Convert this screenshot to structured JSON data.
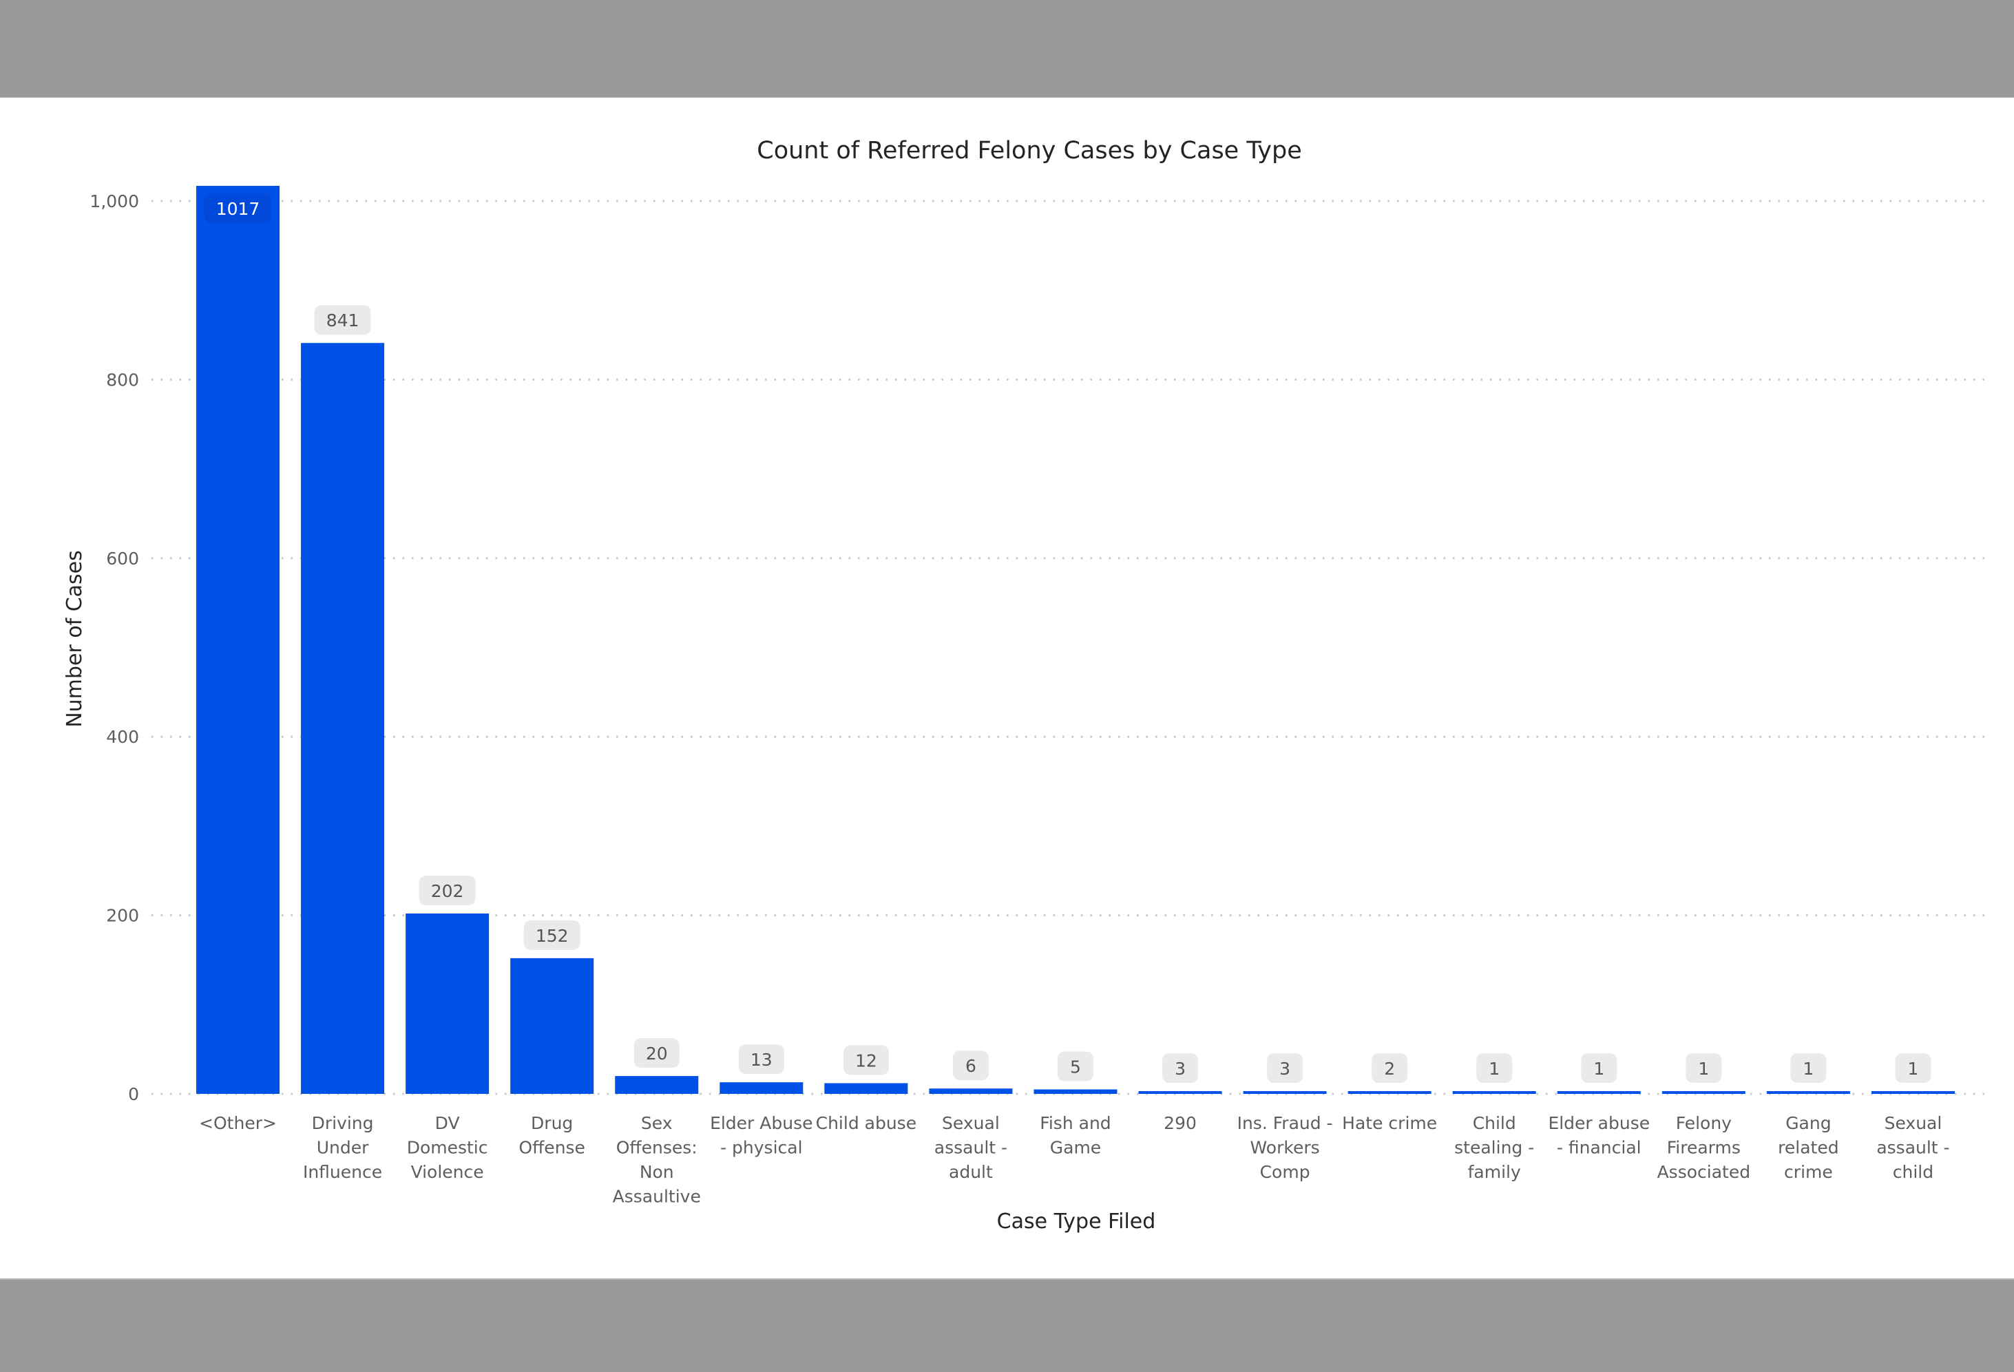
{
  "chart_data": {
    "type": "bar",
    "title": "Count of Referred Felony Cases by Case Type",
    "xlabel": "Case Type Filed",
    "ylabel": "Number of Cases",
    "ylim": [
      0,
      1017
    ],
    "yticks": [
      0,
      200,
      400,
      600,
      800,
      1000
    ],
    "ytick_labels": [
      "0",
      "200",
      "400",
      "600",
      "800",
      "1,000"
    ],
    "grid": true,
    "grid_style": "dotted",
    "legend": "none",
    "bar_color": "#0051E8",
    "categories": [
      "<Other>",
      "Driving Under Influence",
      "DV Domestic Violence",
      "Drug Offense",
      "Sex Offenses: Non Assaultive",
      "Elder Abuse - physical",
      "Child abuse",
      "Sexual assault - adult",
      "Fish and Game",
      "290",
      "Ins. Fraud - Workers Comp",
      "Hate crime",
      "Child stealing - family",
      "Elder abuse - financial",
      "Felony Firearms Associated",
      "Gang related crime",
      "Sexual assault - child"
    ],
    "category_lines": [
      [
        "<Other>"
      ],
      [
        "Driving",
        "Under",
        "Influence"
      ],
      [
        "DV",
        "Domestic",
        "Violence"
      ],
      [
        "Drug",
        "Offense"
      ],
      [
        "Sex",
        "Offenses:",
        "Non",
        "Assaultive"
      ],
      [
        "Elder Abuse",
        "- physical"
      ],
      [
        "Child abuse"
      ],
      [
        "Sexual",
        "assault -",
        "adult"
      ],
      [
        "Fish and",
        "Game"
      ],
      [
        "290"
      ],
      [
        "Ins. Fraud -",
        "Workers",
        "Comp"
      ],
      [
        "Hate crime"
      ],
      [
        "Child",
        "stealing -",
        "family"
      ],
      [
        "Elder abuse",
        "- financial"
      ],
      [
        "Felony",
        "Firearms",
        "Associated"
      ],
      [
        "Gang",
        "related",
        "crime"
      ],
      [
        "Sexual",
        "assault -",
        "child"
      ]
    ],
    "values": [
      1017,
      841,
      202,
      152,
      20,
      13,
      12,
      6,
      5,
      3,
      3,
      2,
      1,
      1,
      1,
      1,
      1
    ],
    "data_labels": [
      "1017",
      "841",
      "202",
      "152",
      "20",
      "13",
      "12",
      "6",
      "5",
      "3",
      "3",
      "2",
      "1",
      "1",
      "1",
      "1",
      "1"
    ]
  }
}
